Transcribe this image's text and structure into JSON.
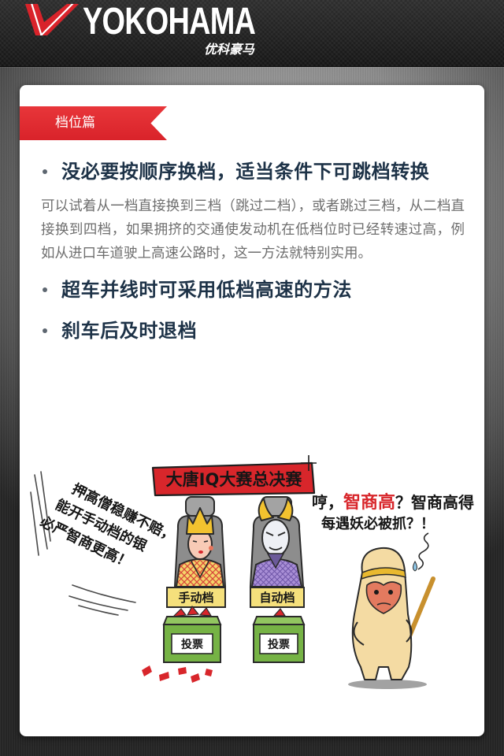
{
  "header": {
    "logo_icon": "yokohama-stripes-logo",
    "brand": "YOKOHAMA",
    "brand_cn": "优科豪马"
  },
  "article": {
    "section_tag": "档位篇",
    "tips": [
      {
        "title": "没必要按顺序换档，适当条件下可跳档转换",
        "body": "可以试着从一档直接换到三档（跳过二档），或者跳过三档，从二档直接换到四档，如果拥挤的交通使发动机在低档位时已经转速过高，例如从进口车道驶上高速公路时，这一方法就特别实用。"
      },
      {
        "title": "超车并线时可采用低档高速的方法"
      },
      {
        "title": "刹车后及时退档"
      }
    ]
  },
  "illustration": {
    "banner": "大唐IQ大赛总决赛",
    "left_caption": [
      "押高僧稳赚不赔，",
      "能开手动档的银",
      "必严智商更高！"
    ],
    "right_caption": {
      "prefix": "哼，",
      "highlight": "智商高",
      "line1_rest": "？智商高得",
      "line2": "每遇妖必被抓？！"
    },
    "label_manual": "手动档",
    "label_auto": "自动档",
    "ballot_label": "投票"
  },
  "colors": {
    "accent": "#d9232a",
    "heading": "#1d3247",
    "body_text": "#6e6e6e",
    "bullet": "#5d6670",
    "header_bg": "#2c2c2c",
    "card_bg": "#ffffff"
  }
}
